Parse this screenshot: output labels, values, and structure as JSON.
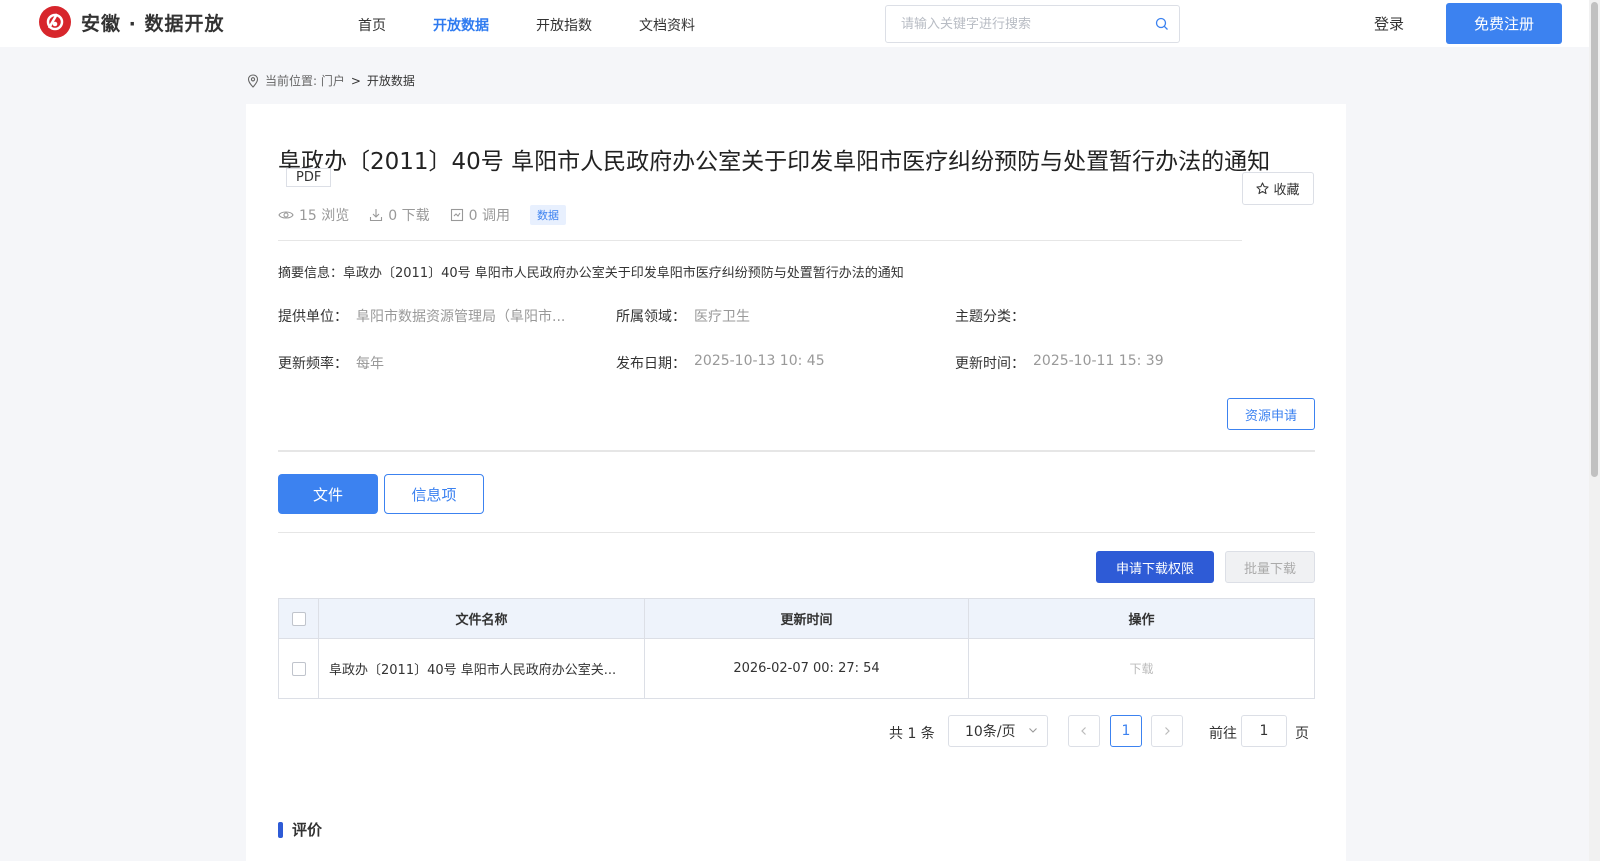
{
  "header": {
    "brand": "安徽 · 数据开放",
    "nav": [
      "首页",
      "开放数据",
      "开放指数",
      "文档资料"
    ],
    "active_nav": "开放数据",
    "search_placeholder": "请输入关键字进行搜索",
    "login": "登录",
    "register": "免费注册"
  },
  "breadcrumb": {
    "prefix": "当前位置: 门户",
    "sep": ">",
    "current": "开放数据"
  },
  "dataset": {
    "title": "阜政办〔2011〕40号 阜阳市人民政府办公室关于印发阜阳市医疗纠纷预防与处置暂行办法的通知",
    "format": "PDF",
    "favorite": "收藏",
    "stats": {
      "views": "15 浏览",
      "downloads": "0 下载",
      "calls": "0 调用"
    },
    "type_tag": "数据",
    "summary": "摘要信息：阜政办〔2011〕40号 阜阳市人民政府办公室关于印发阜阳市医疗纠纷预防与处置暂行办法的通知",
    "meta": {
      "provider_label": "提供单位：",
      "provider": "阜阳市数据资源管理局（阜阳市...",
      "domain_label": "所属领域：",
      "domain": "医疗卫生",
      "topic_label": "主题分类：",
      "topic": "",
      "freq_label": "更新频率：",
      "freq": "每年",
      "pub_label": "发布日期：",
      "pub": "2025-10-13 10: 45",
      "upd_label": "更新时间：",
      "upd": "2025-10-11 15: 39"
    },
    "apply_button": "资源申请"
  },
  "tabs": [
    "文件",
    "信息项"
  ],
  "actions": {
    "request_download": "申请下载权限",
    "batch_download": "批量下载"
  },
  "table": {
    "headers": [
      "文件名称",
      "更新时间",
      "操作"
    ],
    "rows": [
      {
        "name": "阜政办〔2011〕40号 阜阳市人民政府办公室关...",
        "time": "2026-02-07 00: 27: 54",
        "action": "下载"
      }
    ]
  },
  "pagination": {
    "total": "共 1 条",
    "page_size": "10条/页",
    "current_page": "1",
    "goto_prefix": "前往",
    "goto_value": "1",
    "goto_suffix": "页"
  },
  "review": {
    "title": "评价"
  },
  "colors": {
    "brand_red": "#d7262c",
    "primary": "#3c82f0",
    "primary_dark": "#2e5bd6"
  }
}
